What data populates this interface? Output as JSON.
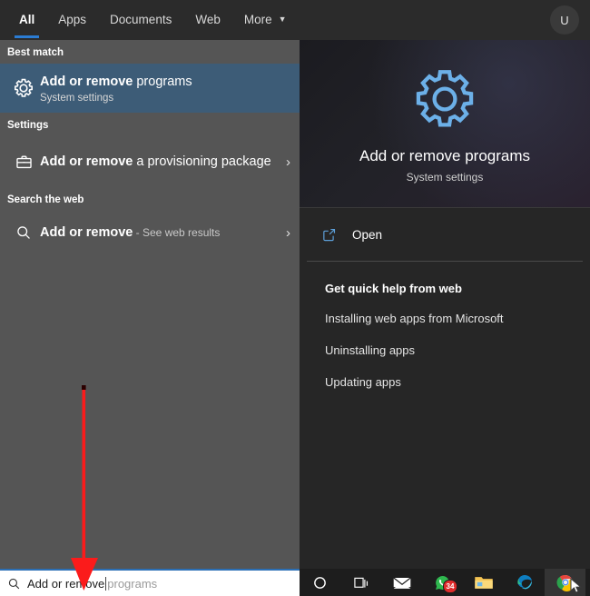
{
  "header": {
    "tabs": [
      {
        "label": "All",
        "active": true
      },
      {
        "label": "Apps",
        "active": false
      },
      {
        "label": "Documents",
        "active": false
      },
      {
        "label": "Web",
        "active": false
      },
      {
        "label": "More",
        "active": false,
        "caret": "▼"
      }
    ],
    "avatar_initial": "U",
    "accent_color": "#2b7cd3"
  },
  "left_panel": {
    "best_match": {
      "section_label": "Best match",
      "icon": "gear-icon",
      "title_bold": "Add or remove",
      "title_rest": " programs",
      "subtitle": "System settings",
      "highlight_color": "#3d5c77"
    },
    "settings": {
      "section_label": "Settings",
      "icon": "briefcase-icon",
      "title_bold": "Add or remove",
      "title_rest": " a provisioning package",
      "chevron": "›"
    },
    "search_web": {
      "section_label": "Search the web",
      "icon": "search-icon",
      "title_bold": "Add or remove",
      "title_rest": " - See web results",
      "chevron": "›"
    }
  },
  "right_panel": {
    "preview": {
      "icon": "gear-icon",
      "icon_color": "#6cb0e8",
      "title": "Add or remove programs",
      "subtitle": "System settings"
    },
    "open_action": {
      "icon": "open-external-icon",
      "label": "Open"
    },
    "quick_help": {
      "heading": "Get quick help from web",
      "links": [
        "Installing web apps from Microsoft",
        "Uninstalling apps",
        "Updating apps"
      ]
    }
  },
  "search_bar": {
    "icon": "search-icon",
    "typed_text": "Add or remove",
    "suggestion_text": "programs"
  },
  "taskbar": {
    "items": [
      {
        "name": "cortana-icon",
        "label": "Cortana"
      },
      {
        "name": "task-view-icon",
        "label": "Task View"
      },
      {
        "name": "mail-icon",
        "label": "Mail"
      },
      {
        "name": "whatsapp-icon",
        "label": "WhatsApp",
        "badge": "34"
      },
      {
        "name": "file-explorer-icon",
        "label": "File Explorer"
      },
      {
        "name": "edge-icon",
        "label": "Microsoft Edge"
      },
      {
        "name": "chrome-icon",
        "label": "Google Chrome"
      }
    ]
  },
  "annotation": {
    "arrow_color": "#fb1b1b",
    "arrow_target": "search-bar"
  }
}
